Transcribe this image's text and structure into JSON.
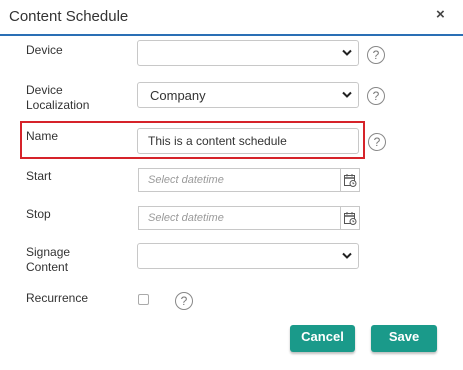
{
  "dialog": {
    "title": "Content Schedule",
    "close_glyph": "×"
  },
  "fields": {
    "device": {
      "label": "Device",
      "value": ""
    },
    "device_localization": {
      "label_line1": "Device",
      "label_line2": "Localization",
      "value": "Company"
    },
    "name": {
      "label": "Name",
      "value": "This is a content schedule"
    },
    "start": {
      "label": "Start",
      "placeholder": "Select datetime"
    },
    "stop": {
      "label": "Stop",
      "placeholder": "Select datetime"
    },
    "signage_content": {
      "label_line1": "Signage",
      "label_line2": "Content",
      "value": ""
    },
    "recurrence": {
      "label": "Recurrence",
      "checked": false
    }
  },
  "help_glyph": "?",
  "buttons": {
    "cancel": "Cancel",
    "save": "Save"
  },
  "colors": {
    "header_border": "#2a6fb5",
    "highlight_border": "#d6232a",
    "button_bg": "#1a9a8a"
  }
}
